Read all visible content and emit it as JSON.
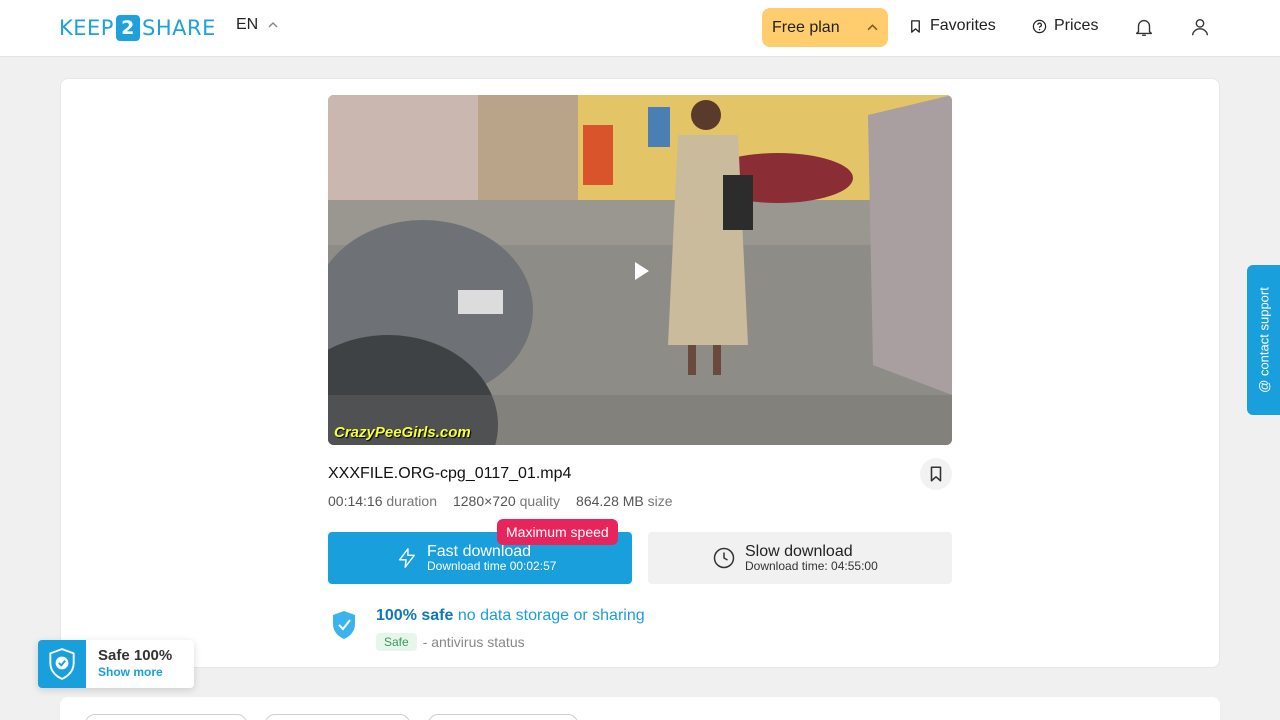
{
  "header": {
    "logo_left": "KEEP",
    "logo_mid": "2",
    "logo_right": "SHARE",
    "language": "EN",
    "free_plan": "Free plan",
    "favorites": "Favorites",
    "prices": "Prices"
  },
  "video": {
    "watermark": "CrazyPeeGirls.com"
  },
  "file": {
    "name": "XXXFILE.ORG-cpg_0117_01.mp4",
    "duration_value": "00:14:16",
    "duration_label": "duration",
    "quality_value": "1280×720",
    "quality_label": "quality",
    "size_value": "864.28 MB",
    "size_label": "size"
  },
  "download": {
    "badge": "Maximum speed",
    "fast_title": "Fast download",
    "fast_sub": "Download time 00:02:57",
    "slow_title": "Slow download",
    "slow_sub": "Download time: 04:55:00"
  },
  "safety": {
    "headline_bold": "100% safe",
    "headline_rest": "no data storage or sharing",
    "status_pill": "Safe",
    "status_text": "- antivirus status"
  },
  "support": {
    "label": "@ contact support"
  },
  "safe_widget": {
    "title": "Safe 100%",
    "link": "Show more"
  },
  "colors": {
    "brand": "#1ea1db",
    "free_plan": "#ffcd6d",
    "badge": "#e8245c"
  }
}
